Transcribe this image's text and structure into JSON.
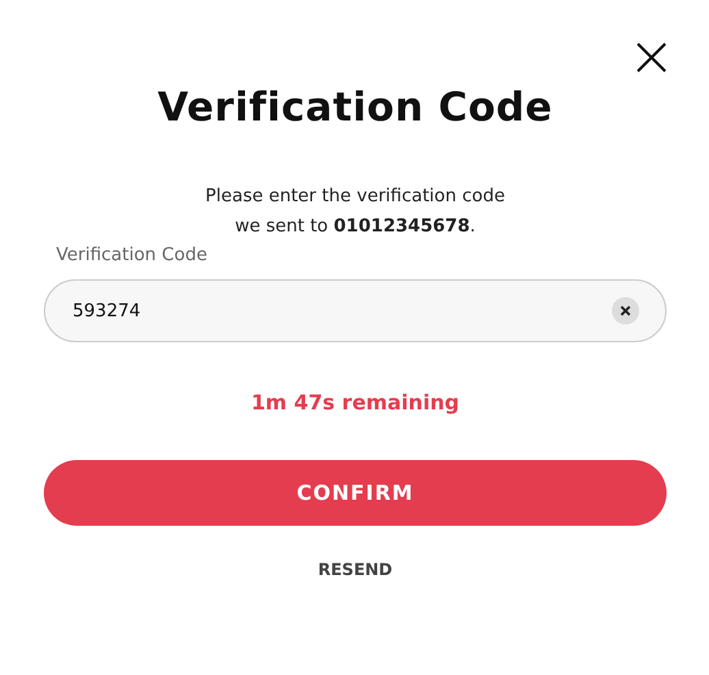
{
  "dialog": {
    "title": "Verification Code",
    "message": "Please enter the verification code\nwe sent to **01012345678**.",
    "field": {
      "label": "Verification Code",
      "value": "593274"
    },
    "timer": "1m 47s remaining",
    "confirm_button": "CONFIRM",
    "resend_link": "RESEND"
  }
}
